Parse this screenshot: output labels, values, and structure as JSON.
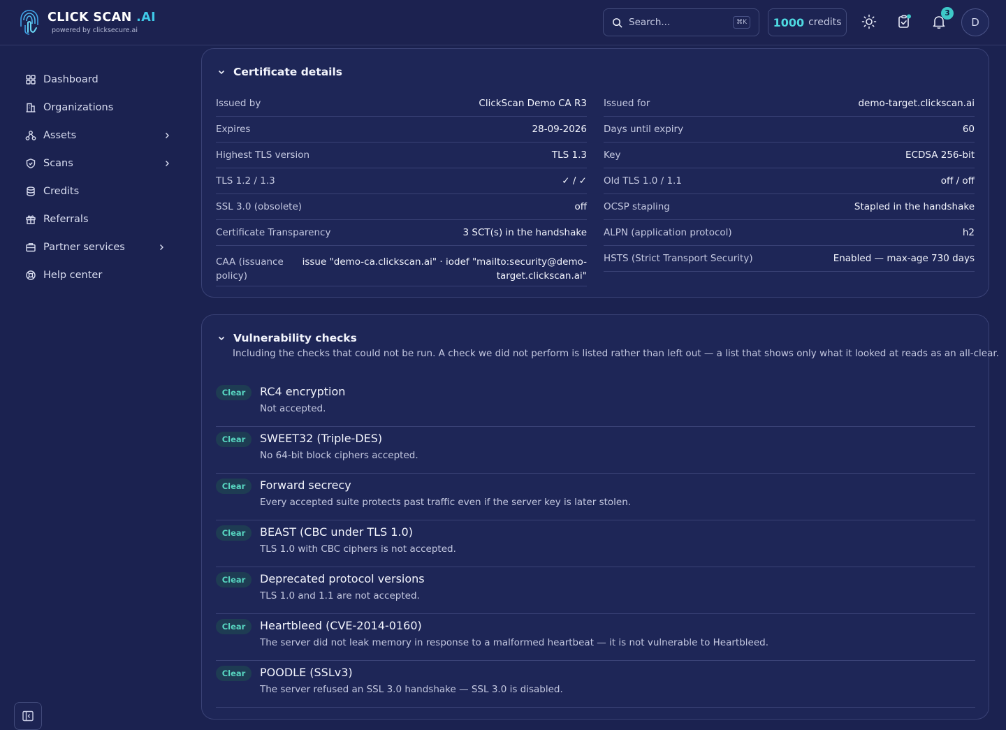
{
  "brand": {
    "name_main": "CLICK SCAN ",
    "name_accent": ".AI",
    "tagline": "powered by clicksecure.ai"
  },
  "header": {
    "search_placeholder": "Search...",
    "search_shortcut": "⌘K",
    "credits_value": "1000",
    "credits_label": "credits",
    "notification_count": "3",
    "avatar_initial": "D"
  },
  "sidebar": {
    "items": [
      {
        "label": "Dashboard",
        "icon": "grid-icon",
        "expandable": false
      },
      {
        "label": "Organizations",
        "icon": "building-icon",
        "expandable": false
      },
      {
        "label": "Assets",
        "icon": "network-icon",
        "expandable": true
      },
      {
        "label": "Scans",
        "icon": "shield-icon",
        "expandable": true
      },
      {
        "label": "Credits",
        "icon": "coins-icon",
        "expandable": false
      },
      {
        "label": "Referrals",
        "icon": "gift-icon",
        "expandable": false
      },
      {
        "label": "Partner services",
        "icon": "briefcase-icon",
        "expandable": true
      },
      {
        "label": "Help center",
        "icon": "lifebuoy-icon",
        "expandable": false
      }
    ]
  },
  "certificate": {
    "title": "Certificate details",
    "left": [
      {
        "key": "Issued by",
        "value": "ClickScan Demo CA R3"
      },
      {
        "key": "Expires",
        "value": "28-09-2026"
      },
      {
        "key": "Highest TLS version",
        "value": "TLS 1.3"
      },
      {
        "key": "TLS 1.2 / 1.3",
        "value": "✓ / ✓"
      },
      {
        "key": "SSL 3.0 (obsolete)",
        "value": "off"
      },
      {
        "key": "Certificate Transparency",
        "value": "3 SCT(s) in the handshake"
      },
      {
        "key": "CAA (issuance policy)",
        "value": "issue \"demo-ca.clickscan.ai\" · iodef \"mailto:security@demo-target.clickscan.ai\""
      }
    ],
    "right": [
      {
        "key": "Issued for",
        "value": "demo-target.clickscan.ai"
      },
      {
        "key": "Days until expiry",
        "value": "60"
      },
      {
        "key": "Key",
        "value": "ECDSA 256-bit"
      },
      {
        "key": "Old TLS 1.0 / 1.1",
        "value": "off / off"
      },
      {
        "key": "OCSP stapling",
        "value": "Stapled in the handshake"
      },
      {
        "key": "ALPN (application protocol)",
        "value": "h2"
      },
      {
        "key": "HSTS (Strict Transport Security)",
        "value": "Enabled — max-age 730 days"
      }
    ]
  },
  "vulnerabilities": {
    "title": "Vulnerability checks",
    "subtitle": "Including the checks that could not be run. A check we did not perform is listed rather than left out — a list that shows only what it looked at reads as an all-clear.",
    "status_color": "#57d5c0",
    "checks": [
      {
        "status": "Clear",
        "title": "RC4 encryption",
        "desc": "Not accepted."
      },
      {
        "status": "Clear",
        "title": "SWEET32 (Triple-DES)",
        "desc": "No 64-bit block ciphers accepted."
      },
      {
        "status": "Clear",
        "title": "Forward secrecy",
        "desc": "Every accepted suite protects past traffic even if the server key is later stolen."
      },
      {
        "status": "Clear",
        "title": "BEAST (CBC under TLS 1.0)",
        "desc": "TLS 1.0 with CBC ciphers is not accepted."
      },
      {
        "status": "Clear",
        "title": "Deprecated protocol versions",
        "desc": "TLS 1.0 and 1.1 are not accepted."
      },
      {
        "status": "Clear",
        "title": "Heartbleed (CVE-2014-0160)",
        "desc": "The server did not leak memory in response to a malformed heartbeat — it is not vulnerable to Heartbleed."
      },
      {
        "status": "Clear",
        "title": "POODLE (SSLv3)",
        "desc": "The server refused an SSL 3.0 handshake — SSL 3.0 is disabled."
      }
    ]
  }
}
